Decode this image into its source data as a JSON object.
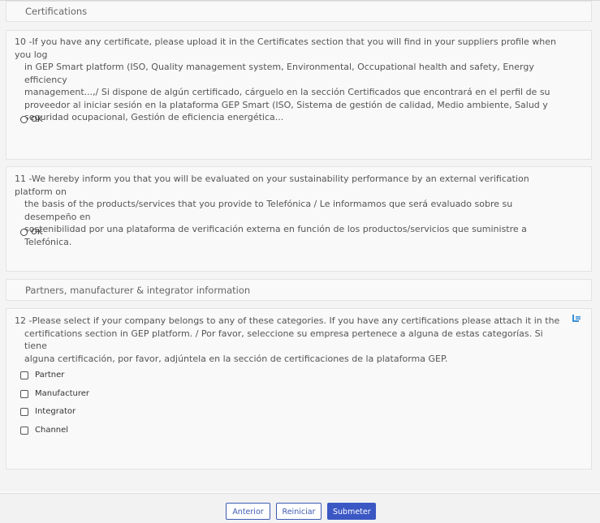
{
  "sections": {
    "certifications_header": "Certifications",
    "partners_header": "Partners, manufacturer & integrator information"
  },
  "questions": {
    "q10": {
      "number": "10 -",
      "lines": [
        "If you have any certificate, please upload it in the Certificates section that you will find in your suppliers profile when you log",
        "in GEP Smart platform (ISO, Quality management system, Environmental, Occupational health and safety, Energy efficiency",
        "management...,/ Si dispone de algún certificado, cárguelo en la sección Certificados que encontrará en el perfil de su",
        "proveedor al iniciar sesión en la plataforma GEP Smart (ISO, Sistema de gestión de calidad, Medio ambiente, Salud y",
        "seguridad ocupacional, Gestión de eficiencia energética..."
      ],
      "option": "OK"
    },
    "q11": {
      "number": "11 -",
      "lines": [
        "We hereby inform you that you will be evaluated on your sustainability performance by an external verification platform on",
        "the basis of the products/services that you provide to Telefónica / Le informamos que será evaluado sobre su desempeño en",
        "sostenibilidad por una plataforma de verificación externa en función de los productos/servicios que suministre a Telefónica."
      ],
      "option": "OK"
    },
    "q12": {
      "number": "12 -",
      "lines": [
        "Please select if your company belongs to any of these categories. If you have any certifications please attach it in the",
        "certifications section in GEP platform. / Por favor, seleccione su empresa pertenece a alguna de estas categorías. Si tiene",
        "alguna certificación, por favor, adjúntela en la sección de certificaciones de la plataforma GEP."
      ],
      "options": [
        "Partner",
        "Manufacturer",
        "Integrator",
        "Channel"
      ],
      "icon": "attachment-icon"
    }
  },
  "footer": {
    "prev_label": "Anterior",
    "reset_label": "Reiniciar",
    "submit_label": "Submeter"
  },
  "colors": {
    "primary": "#3b57c4",
    "icon_blue": "#3b8fd6"
  }
}
